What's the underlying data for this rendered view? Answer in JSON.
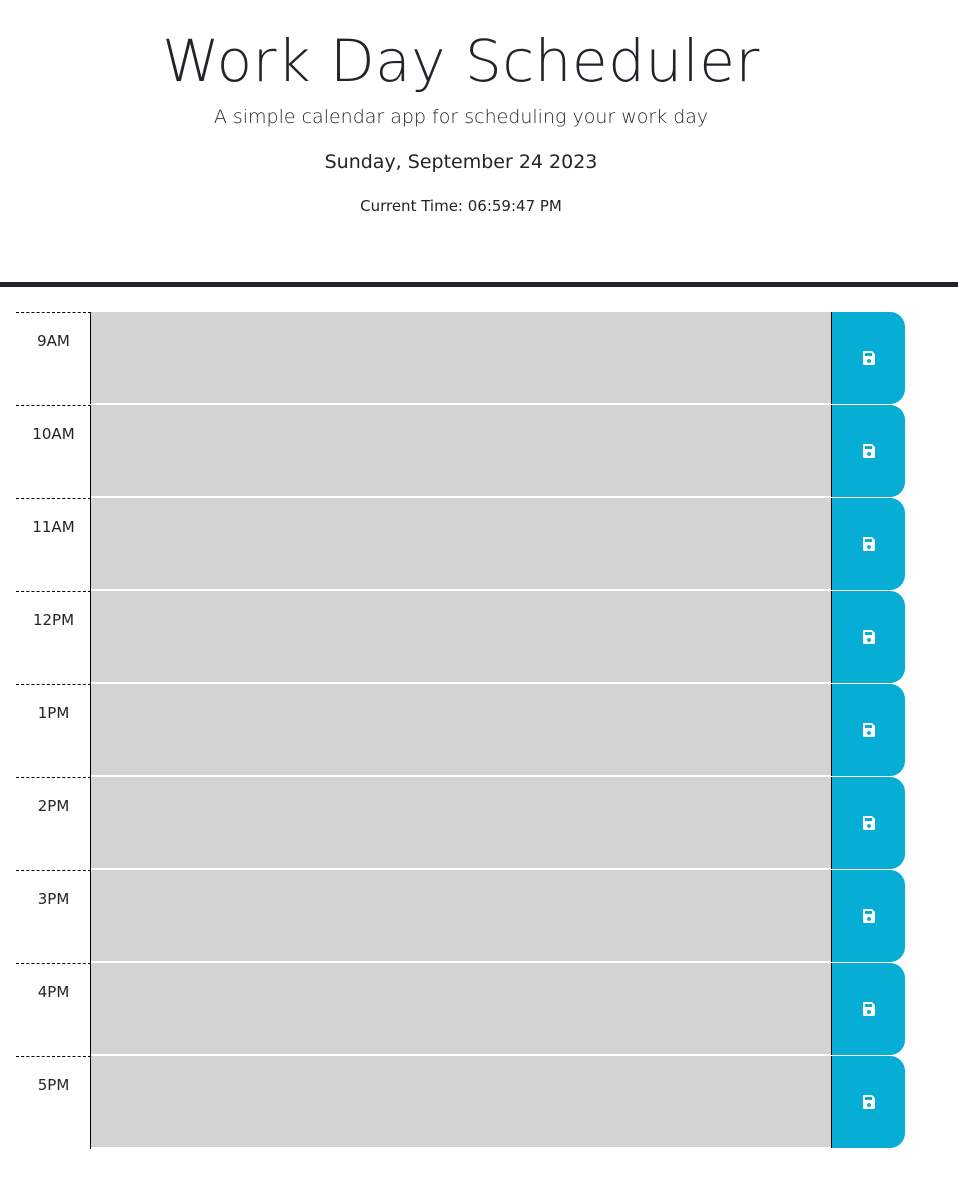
{
  "header": {
    "title": "Work Day Scheduler",
    "subtitle": "A simple calendar app for scheduling your work day",
    "date": "Sunday, September 24 2023",
    "current_time": "Current Time: 06:59:47 PM"
  },
  "colors": {
    "text": "#212529",
    "past_block": "#d3d3d3",
    "save_button": "#06aed5",
    "save_icon": "#ffffff"
  },
  "hours": [
    {
      "label": "9AM",
      "text": ""
    },
    {
      "label": "10AM",
      "text": ""
    },
    {
      "label": "11AM",
      "text": ""
    },
    {
      "label": "12PM",
      "text": ""
    },
    {
      "label": "1PM",
      "text": ""
    },
    {
      "label": "2PM",
      "text": ""
    },
    {
      "label": "3PM",
      "text": ""
    },
    {
      "label": "4PM",
      "text": ""
    },
    {
      "label": "5PM",
      "text": ""
    }
  ],
  "icons": {
    "save": "floppy-disk-icon"
  }
}
